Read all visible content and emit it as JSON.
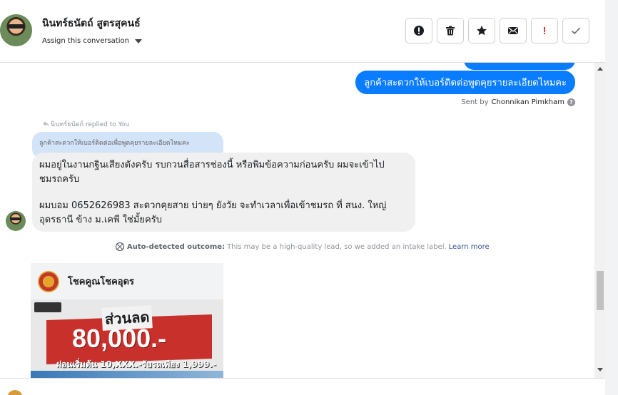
{
  "header": {
    "contact_name": "นินทร์ธนัตถ์ สูตรสุคนธ์",
    "assign_label": "Assign this conversation",
    "actions": [
      {
        "name": "report-spam-button",
        "icon": "exclamation-circle-icon"
      },
      {
        "name": "delete-button",
        "icon": "trash-icon"
      },
      {
        "name": "star-button",
        "icon": "star-icon"
      },
      {
        "name": "mark-unread-button",
        "icon": "envelope-icon"
      },
      {
        "name": "follow-up-button",
        "icon": "red-exclamation-icon",
        "text": "!"
      },
      {
        "name": "mark-done-button",
        "icon": "check-icon"
      }
    ]
  },
  "messages": {
    "outgoing_text": "ลูกค้าสะดวกให้เบอร์ติดต่อพูดคุยรายละเอียดไหมคะ",
    "sent_by_prefix": "Sent by",
    "sent_by_name": "Chonnikan Pimkham",
    "replied_to": "นินทร์ธนัตถ์ replied to You",
    "quoted_text": "ลูกค้าสะดวกให้เบอร์ติดต่อเพื่อพูดคุยรายละเอียดไหมคะ",
    "incoming_line1": "ผมอยู่ในงานกฐินเสียงดังครับ รบกวนสื่อสารช่องนี้ หรือพิมข้อความก่อนครับ ผมจะเข้าไป",
    "incoming_line2": "ชมรถครับ",
    "incoming_line3": "ผมบอม 0652626983 สะดวกคุยสาย บ่ายๆ ยังวัย จะทำเวลาเพื่อเข้าชมรถ ที่ สนง. ใหญ่",
    "incoming_line4": "อุดรธานี ข้าง ม.เคพี ใช่มั้ยครับ"
  },
  "outcome": {
    "label": "Auto-detected outcome:",
    "text": "This may be a high-quality lead, so we added an intake label.",
    "link": "Learn more"
  },
  "card": {
    "page_name": "โชคคูณโชคอุดร",
    "discount_label": "ส่วนลด",
    "price": "80,000.-",
    "promo": "ผ่อนเริ่มต้น 10,XXX.-รับรถเพียง 1,999.-"
  },
  "colors": {
    "outgoing_bubble": "#0a7cff",
    "incoming_bubble": "#f0f0f0",
    "quoted_bubble": "#d3e3f8",
    "card_red": "#c8302b",
    "follow_up_red": "#e4303c"
  }
}
